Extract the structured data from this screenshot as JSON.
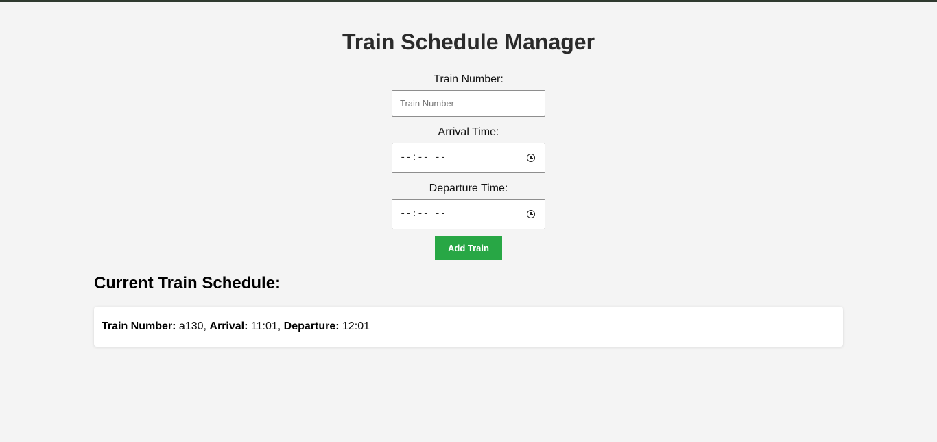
{
  "page": {
    "title": "Train Schedule Manager"
  },
  "form": {
    "train_number_label": "Train Number:",
    "train_number_placeholder": "Train Number",
    "train_number_value": "",
    "arrival_label": "Arrival Time:",
    "arrival_value": "--:-- --",
    "departure_label": "Departure Time:",
    "departure_value": "--:-- --",
    "add_button_label": "Add Train"
  },
  "schedule": {
    "heading": "Current Train Schedule:",
    "items": [
      {
        "train_number_label": "Train Number:",
        "train_number": "a130",
        "arrival_label": "Arrival:",
        "arrival": "11:01",
        "departure_label": "Departure:",
        "departure": "12:01"
      }
    ]
  },
  "colors": {
    "background": "#f4f4f4",
    "top_bar": "#2f3a2f",
    "button": "#28a745",
    "button_text": "#ffffff",
    "card": "#ffffff"
  },
  "icons": {
    "time_picker": "clock-icon"
  }
}
